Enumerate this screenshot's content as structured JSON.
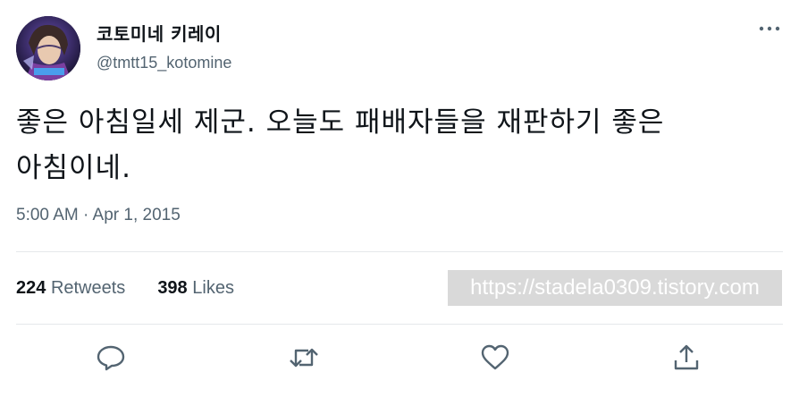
{
  "tweet": {
    "display_name": "코토미네 키레이",
    "handle": "@tmtt15_kotomine",
    "text_line1": "좋은 아침일세 제군. 오늘도 패배자들을 재판하기 좋은",
    "text_line2": "아침이네.",
    "timestamp": "5:00 AM · Apr 1, 2015"
  },
  "stats": {
    "retweets_count": "224",
    "retweets_label": "Retweets",
    "likes_count": "398",
    "likes_label": "Likes"
  },
  "watermark": "https://stadela0309.tistory.com",
  "icons": {
    "more": "more-icon",
    "reply": "reply-icon",
    "retweet": "retweet-icon",
    "like": "like-icon",
    "share": "share-icon"
  },
  "colors": {
    "text": "#0f1419",
    "secondary": "#536471",
    "divider": "#e5e8eb"
  }
}
